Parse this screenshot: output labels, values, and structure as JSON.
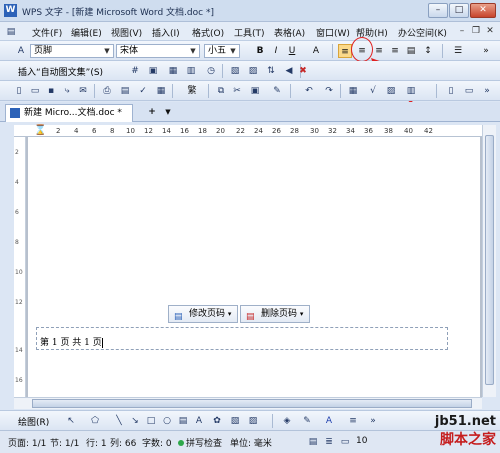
{
  "window": {
    "title": "WPS 文字 - [新建 Microsoft Word 文档.doc *]",
    "app_icon": "W"
  },
  "window_controls": {
    "minimize": "–",
    "maximize": "□",
    "close": "✕"
  },
  "menu": {
    "items": [
      "文件(F)",
      "编辑(E)",
      "视图(V)",
      "插入(I)",
      "格式(O)",
      "工具(T)",
      "表格(A)",
      "窗口(W)",
      "帮助(H)",
      "办公空间(K)"
    ],
    "doc_min": "–",
    "doc_restore": "❐",
    "doc_close": "✕"
  },
  "format_toolbar": {
    "style": "页脚",
    "font": "宋体",
    "size": "小五",
    "bold": "B",
    "italic": "I",
    "underline": "U",
    "font_color": "A"
  },
  "autotext_toolbar": {
    "insert_autotext": "插入“自动图文集”(S)"
  },
  "std_toolbar": {
    "traditional": "繁"
  },
  "doc_tabs": {
    "active": "新建 Micro...文档.doc *",
    "add": "+"
  },
  "ruler": {
    "numbers": [
      "2",
      "4",
      "6",
      "8",
      "10",
      "12",
      "14",
      "16",
      "18",
      "20",
      "22",
      "24",
      "26",
      "28",
      "30",
      "32",
      "34",
      "36",
      "38",
      "40",
      "42"
    ]
  },
  "vruler": {
    "numbers": [
      "2",
      "4",
      "6",
      "8",
      "10",
      "12",
      "14",
      "16"
    ]
  },
  "footer": {
    "edit_page_number": "修改页码",
    "delete_page_number": "删除页码",
    "text": "第 1 页 共 1 页"
  },
  "drawing_toolbar": {
    "draw_menu": "绘图(R)"
  },
  "status": {
    "page": "页面: 1/1",
    "section": "节: 1/1",
    "line": "行: 1",
    "column": "列: 66",
    "chars": "字数: 0",
    "spell": "拼写检查",
    "unit": "单位: 毫米",
    "zoom": "10"
  },
  "watermark": {
    "url": "jb51.net",
    "cn": "脚本之家"
  },
  "colors": {
    "accent": "#fbd98a",
    "highlight": "#e02020",
    "title_bg": "#cfddef"
  }
}
